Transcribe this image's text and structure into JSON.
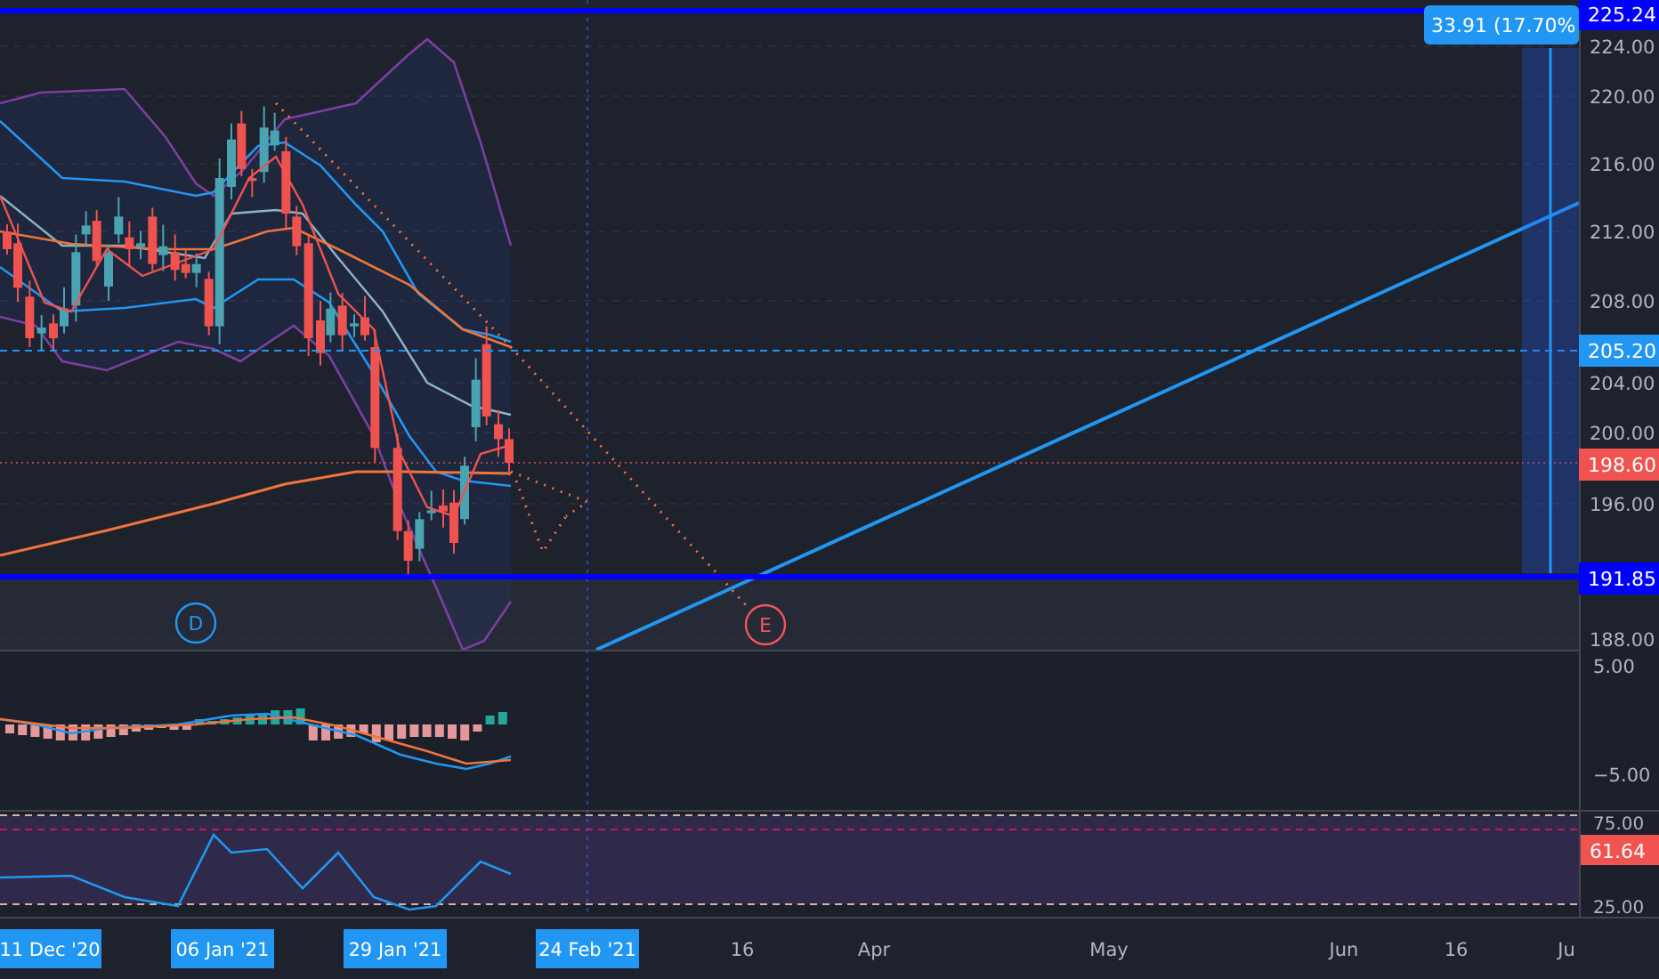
{
  "price_pane": {
    "axis_ticks": [
      "224.00",
      "220.00",
      "216.00",
      "212.00",
      "208.00",
      "204.00",
      "200.00",
      "196.00",
      "188.00"
    ],
    "price_tags": [
      {
        "kind": "line",
        "text": "225.24"
      },
      {
        "kind": "alert",
        "text": "205.20"
      },
      {
        "kind": "last",
        "text": "198.60"
      },
      {
        "kind": "line",
        "text": "191.85"
      }
    ],
    "measure_label": "33.91 (17.70%",
    "pattern_points": [
      {
        "text": "D",
        "color": "#2196f3"
      },
      {
        "text": "E",
        "color": "#f7525f"
      }
    ]
  },
  "macd_pane": {
    "axis_ticks": [
      "5.00",
      "−5.00"
    ]
  },
  "rsi_pane": {
    "axis_ticks": [
      "75.00",
      "25.00"
    ],
    "value_tag": "61.64"
  },
  "time_axis": [
    {
      "text": "11 Dec '20",
      "highlighted": true
    },
    {
      "text": "06 Jan '21",
      "highlighted": true
    },
    {
      "text": "29 Jan '21",
      "highlighted": true
    },
    {
      "text": "24 Feb '21",
      "highlighted": true
    },
    {
      "text": "16",
      "highlighted": false
    },
    {
      "text": "Apr",
      "highlighted": false
    },
    {
      "text": "May",
      "highlighted": false
    },
    {
      "text": "Jun",
      "highlighted": false
    },
    {
      "text": "16",
      "highlighted": false
    },
    {
      "text": "Ju",
      "highlighted": false
    }
  ]
}
